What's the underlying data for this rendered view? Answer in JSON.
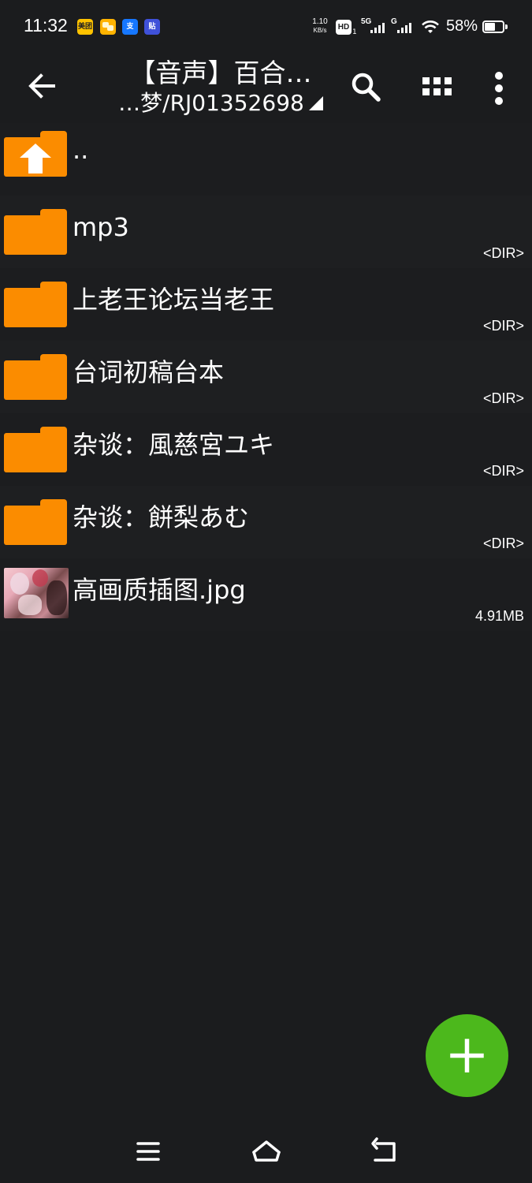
{
  "status_bar": {
    "time": "11:32",
    "apps": [
      {
        "icon": "meituan-icon",
        "label": "美团",
        "bg": "#ffc300",
        "fg": "#222222"
      },
      {
        "icon": "chat-app-icon",
        "label": "",
        "bg": "#ffb300",
        "fg": "#222222"
      },
      {
        "icon": "alipay-icon",
        "label": "支",
        "bg": "#1677ff",
        "fg": "#ffffff"
      },
      {
        "icon": "tieba-icon",
        "label": "贴",
        "bg": "#3f51d9",
        "fg": "#ffffff"
      }
    ],
    "net_speed_value": "1.10",
    "net_speed_unit": "KB/s",
    "hd_label": "HD",
    "sig1_label": "5G",
    "sig2_label": "G",
    "battery_percent_text": "58%",
    "battery_level": 0.58
  },
  "toolbar": {
    "title": "【音声】百合…",
    "path": "…梦/RJ01352698"
  },
  "files": [
    {
      "name": "..",
      "meta": "",
      "type": "parent",
      "icon": "parent-folder-icon"
    },
    {
      "name": "mp3",
      "meta": "<DIR>",
      "type": "dir",
      "icon": "folder-icon"
    },
    {
      "name": "上老王论坛当老王",
      "meta": "<DIR>",
      "type": "dir",
      "icon": "folder-icon"
    },
    {
      "name": "台词初稿台本",
      "meta": "<DIR>",
      "type": "dir",
      "icon": "folder-icon"
    },
    {
      "name": "杂谈：風慈宮ユキ",
      "meta": "<DIR>",
      "type": "dir",
      "icon": "folder-icon"
    },
    {
      "name": "杂谈：餅梨あむ",
      "meta": "<DIR>",
      "type": "dir",
      "icon": "folder-icon"
    },
    {
      "name": "高画质插图.jpg",
      "meta": "4.91MB",
      "type": "image",
      "icon": "image-thumbnail"
    }
  ],
  "colors": {
    "background": "#1b1c1e",
    "folder": "#fb8c00",
    "fab": "#4cb81c"
  }
}
